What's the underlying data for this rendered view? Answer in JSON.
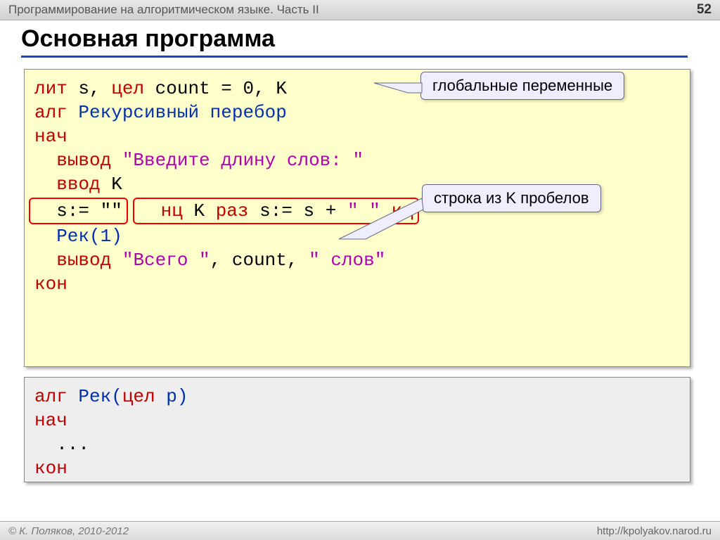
{
  "header": {
    "title": "Программирование на алгоритмическом языке. Часть II",
    "page": "52"
  },
  "slide_title": "Основная программа",
  "callouts": {
    "globals": "глобальные переменные",
    "spaces": "строка из K пробелов"
  },
  "code1": {
    "l1": {
      "lit": "лит",
      "s": " s",
      "comma": ", ",
      "tsel": "цел",
      "count": " count",
      "eq": " = ",
      "zero": "0",
      "k": ", K"
    },
    "l2": {
      "alg": "алг",
      "name": " Рекурсивный перебор"
    },
    "l3": "нач",
    "l4": {
      "out": "  вывод ",
      "str": "\"Введите длину слов: \""
    },
    "l5": "  ввод K",
    "l6": "  s:= \"\"",
    "l7": {
      "nc": "  нц",
      "mid": " K ",
      "raz": "раз",
      "assign": " s:= s + ",
      "sp": "\" \"",
      "kc": " кц"
    },
    "l8": "  Рек(1)",
    "l9": {
      "out": "  вывод ",
      "s1": "\"Всего \"",
      ",": ", count, ",
      "s2": "\" слов\""
    },
    "l10": "кон"
  },
  "code2": {
    "l1": {
      "alg": "алг",
      "name": " Рек(",
      "tsel": "цел",
      "p": " p)"
    },
    "l2": "нач",
    "l3": "  ...",
    "l4": "кон"
  },
  "footer": {
    "copyright": "© К. Поляков, 2010-2012",
    "url": "http://kpolyakov.narod.ru"
  }
}
